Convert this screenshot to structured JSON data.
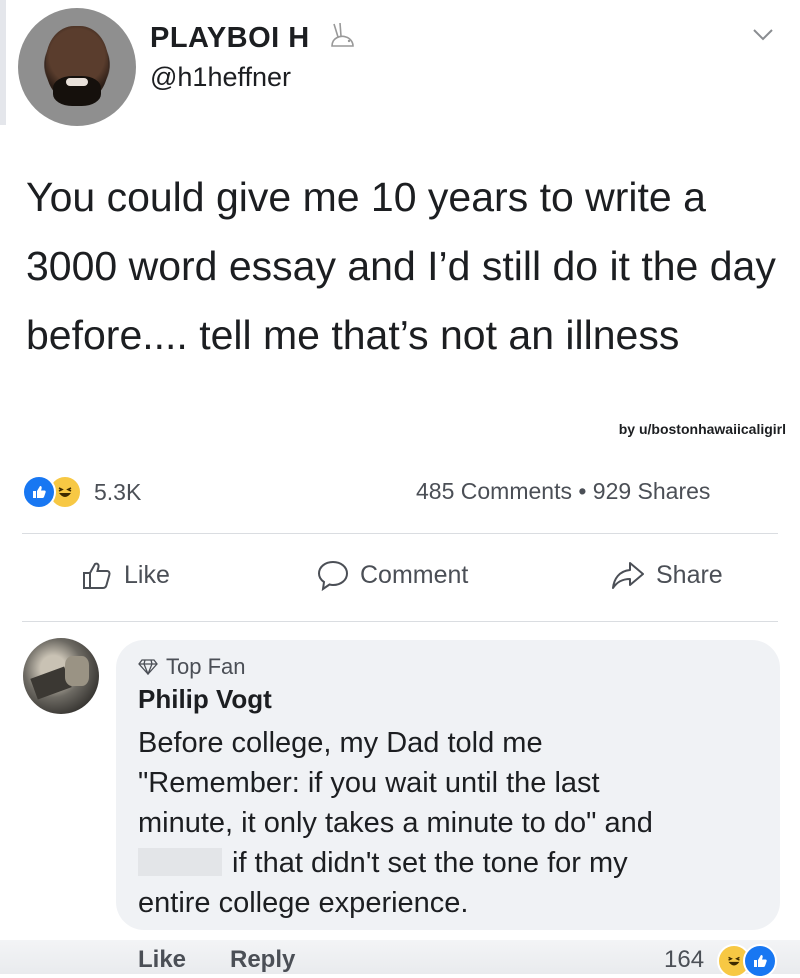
{
  "post": {
    "author_name": "PLAYBOI H",
    "author_handle": "@h1heffner",
    "text": "You could give me 10 years to write a 3000 word essay and I’d still do it the day before.... tell me that’s not an illness",
    "watermark": "by u/bostonhawaiicaligirl"
  },
  "stats": {
    "reaction_count": "5.3K",
    "comments_shares": "485 Comments • 929 Shares"
  },
  "actions": {
    "like": "Like",
    "comment": "Comment",
    "share": "Share"
  },
  "comment": {
    "badge": "Top Fan",
    "author": "Philip Vogt",
    "lines": [
      "Before college, my Dad told me",
      "\"Remember: if you wait until the last",
      "minute, it only takes a minute to do\" and",
      "if that didn't set the tone for my",
      "entire college experience."
    ],
    "like_label": "Like",
    "reply_label": "Reply",
    "reaction_count": "164"
  },
  "colors": {
    "like_blue": "#1877f2",
    "haha_yellow": "#f7c844",
    "secondary_text": "#4b4f56",
    "bubble_bg": "#f0f2f5"
  },
  "icons": [
    "rabbit-icon",
    "chevron-down-icon",
    "like-reaction-icon",
    "haha-reaction-icon",
    "thumbs-up-icon",
    "comment-icon",
    "share-icon",
    "diamond-icon"
  ]
}
